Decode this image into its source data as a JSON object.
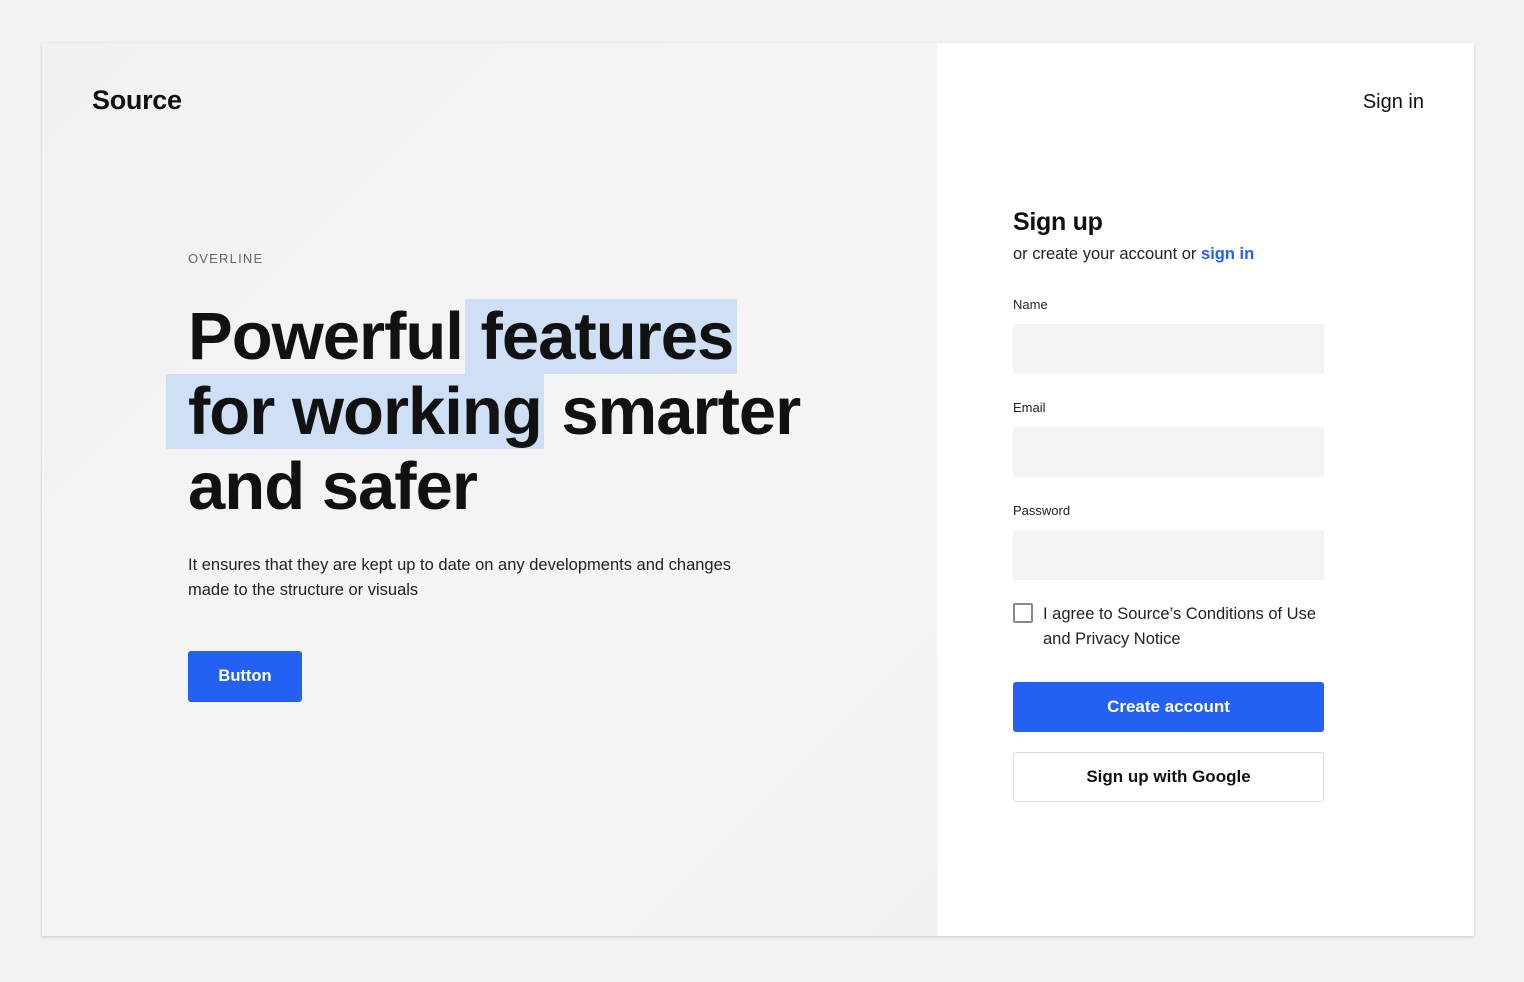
{
  "brand": {
    "logo": "Source"
  },
  "header": {
    "signin_label": "Sign in"
  },
  "hero": {
    "overline": "OVERLINE",
    "headline": {
      "part1": "Powerful",
      "highlight1": "features",
      "highlight2": "for working",
      "part2": "smarter",
      "part3": "and safer"
    },
    "highlight_color": "#cfe0f6",
    "description": "It ensures that they are kept up to date on any developments and changes made to the structure or visuals",
    "button_label": "Button"
  },
  "signup": {
    "title": "Sign up",
    "subtitle_prefix": "or create your account or ",
    "subtitle_link": "sign in",
    "fields": {
      "name": {
        "label": "Name",
        "value": ""
      },
      "email": {
        "label": "Email",
        "value": ""
      },
      "password": {
        "label": "Password",
        "value": ""
      }
    },
    "agree_text": "I agree to Source’s Conditions of Use and Privacy Notice",
    "agree_checked": false,
    "create_label": "Create account",
    "google_label": "Sign up with Google"
  },
  "colors": {
    "accent": "#2461f2",
    "page_bg": "#f2f2f2",
    "input_bg": "#f3f3f3"
  }
}
